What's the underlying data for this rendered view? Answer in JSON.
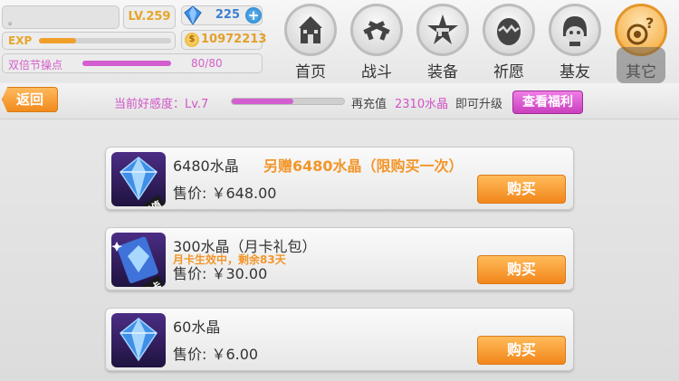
{
  "player": {
    "name": "。",
    "level": "LV.259",
    "gems": "225",
    "exp_label": "EXP",
    "exp_progress": 0.28,
    "coins": "10972213",
    "festival_label": "双倍节操点",
    "festival_value": "80/80",
    "festival_progress": 1.0
  },
  "nav": [
    {
      "label": "首页",
      "icon": "castle-icon"
    },
    {
      "label": "战斗",
      "icon": "crossed-guns-icon"
    },
    {
      "label": "装备",
      "icon": "star-gun-icon"
    },
    {
      "label": "祈愿",
      "icon": "egg-icon"
    },
    {
      "label": "基友",
      "icon": "friend-face-icon"
    },
    {
      "label": "其它",
      "icon": "target-question-icon"
    }
  ],
  "subheader": {
    "back_label": "返回",
    "favor_label": "当前好感度：Lv.7",
    "favor_progress": 0.55,
    "recharge_label": "再充值",
    "recharge_amount": "2310水晶",
    "upgrade_label": "即可升级",
    "benefit_button": "查看福利"
  },
  "products": [
    {
      "title": "6480水晶",
      "bonus": "另赠6480水晶（限购买一次）",
      "note": "",
      "price": "售价: ￥648.00",
      "tag": "超值",
      "buy_label": "购买"
    },
    {
      "title": "300水晶（月卡礼包）",
      "bonus": "",
      "note": "月卡生效中，剩余83天",
      "price": "售价: ￥30.00",
      "tag": "月卡",
      "buy_label": "购买"
    },
    {
      "title": "60水晶",
      "bonus": "",
      "note": "",
      "price": "售价: ￥6.00",
      "tag": "",
      "buy_label": "购买"
    }
  ]
}
